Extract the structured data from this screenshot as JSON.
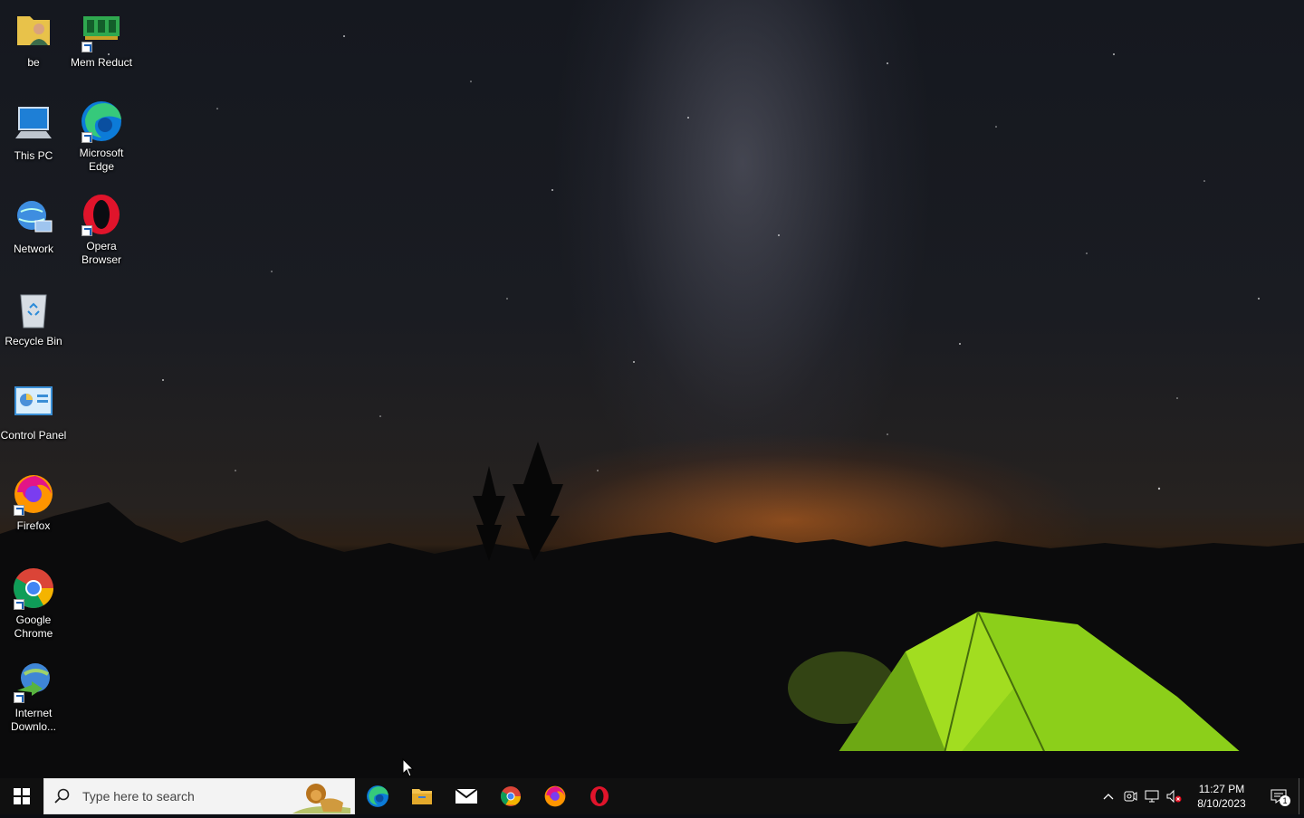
{
  "desktop": {
    "icons": [
      {
        "label": "be",
        "icon": "user-folder-icon",
        "shortcut": false
      },
      {
        "label": "Mem Reduct",
        "icon": "mem-reduct-icon",
        "shortcut": true
      },
      {
        "label": "This PC",
        "icon": "this-pc-icon",
        "shortcut": false
      },
      {
        "label": "Microsoft Edge",
        "icon": "edge-icon",
        "shortcut": true
      },
      {
        "label": "Network",
        "icon": "network-icon",
        "shortcut": false
      },
      {
        "label": "Opera Browser",
        "icon": "opera-icon",
        "shortcut": true
      },
      {
        "label": "Recycle Bin",
        "icon": "recycle-bin-icon",
        "shortcut": false
      },
      {
        "label": "Control Panel",
        "icon": "control-panel-icon",
        "shortcut": false
      },
      {
        "label": "Firefox",
        "icon": "firefox-icon",
        "shortcut": true
      },
      {
        "label": "Google Chrome",
        "icon": "chrome-icon",
        "shortcut": true
      },
      {
        "label": "Internet Downlo...",
        "icon": "idm-icon",
        "shortcut": true
      }
    ]
  },
  "taskbar": {
    "search_placeholder": "Type here to search",
    "pinned": [
      {
        "name": "Microsoft Edge",
        "icon": "edge-icon"
      },
      {
        "name": "File Explorer",
        "icon": "folder-icon"
      },
      {
        "name": "Mail",
        "icon": "mail-icon"
      },
      {
        "name": "Google Chrome",
        "icon": "chrome-icon"
      },
      {
        "name": "Firefox",
        "icon": "firefox-icon"
      },
      {
        "name": "Opera",
        "icon": "opera-icon"
      }
    ],
    "clock": {
      "time": "11:27 PM",
      "date": "8/10/2023"
    },
    "notification_count": "1"
  },
  "colors": {
    "taskbar_bg": "#101010",
    "tent_green": "#8ccf1a",
    "sunset_orange": "#d46a1c"
  }
}
